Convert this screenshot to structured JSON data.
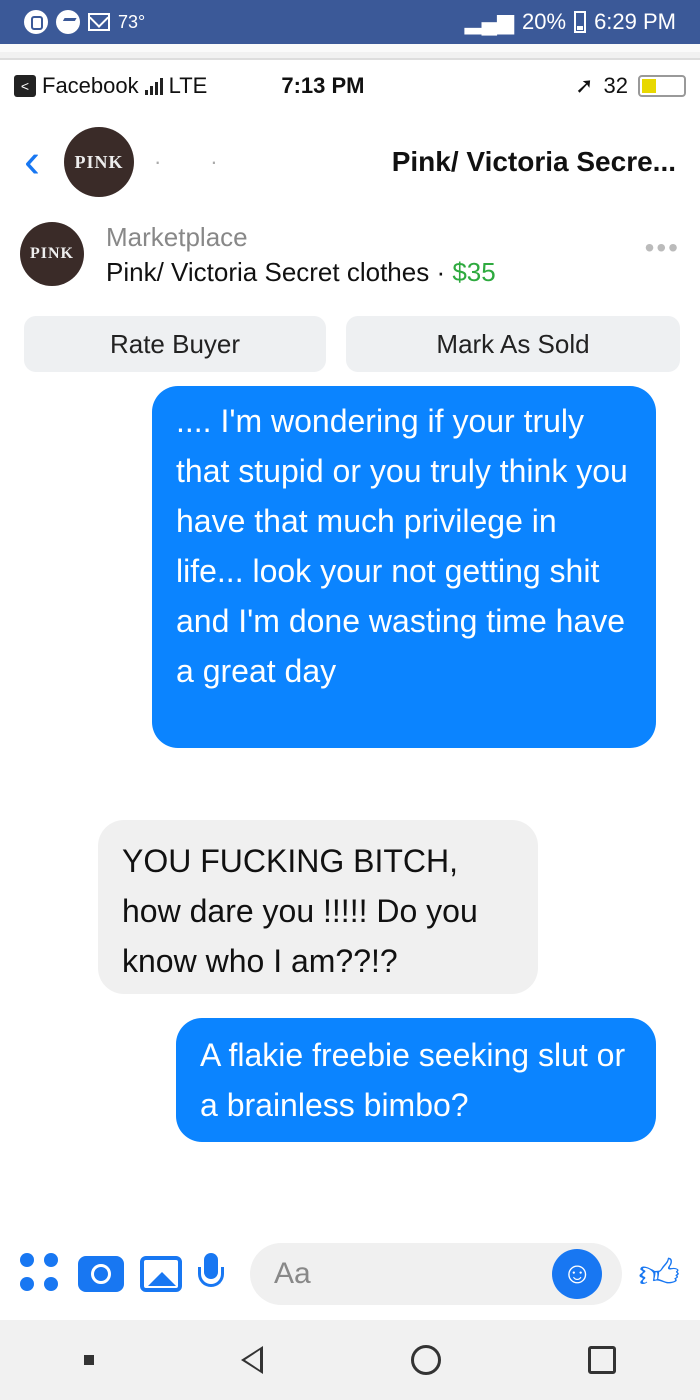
{
  "outer_status": {
    "temperature": "73°",
    "battery": "20%",
    "time": "6:29 PM"
  },
  "inner_status": {
    "back_app": "Facebook",
    "network": "LTE",
    "time": "7:13 PM",
    "battery": "32"
  },
  "header": {
    "avatar_text": "PINK",
    "title": "Pink/ Victoria Secre..."
  },
  "listing": {
    "avatar_text": "PINK",
    "source": "Marketplace",
    "title": "Pink/ Victoria Secret clothes · ",
    "price": "$35"
  },
  "actions": {
    "rate_buyer": "Rate Buyer",
    "mark_sold": "Mark As Sold"
  },
  "messages": [
    {
      "direction": "outgoing",
      "text": ".... I'm wondering if your truly that stupid or you truly think you have that much privilege in life... look your not getting shit and I'm done wasting time have a great day"
    },
    {
      "direction": "incoming",
      "text": "YOU FUCKING BITCH, how dare you !!!!! Do you know who I am??!?"
    },
    {
      "direction": "outgoing",
      "text": "A flakie freebie seeking slut or a brainless bimbo?"
    }
  ],
  "composer": {
    "placeholder": "Aa"
  },
  "colors": {
    "messenger_blue": "#0b84ff",
    "price_green": "#2eaa3f",
    "status_bar": "#3b5998"
  }
}
